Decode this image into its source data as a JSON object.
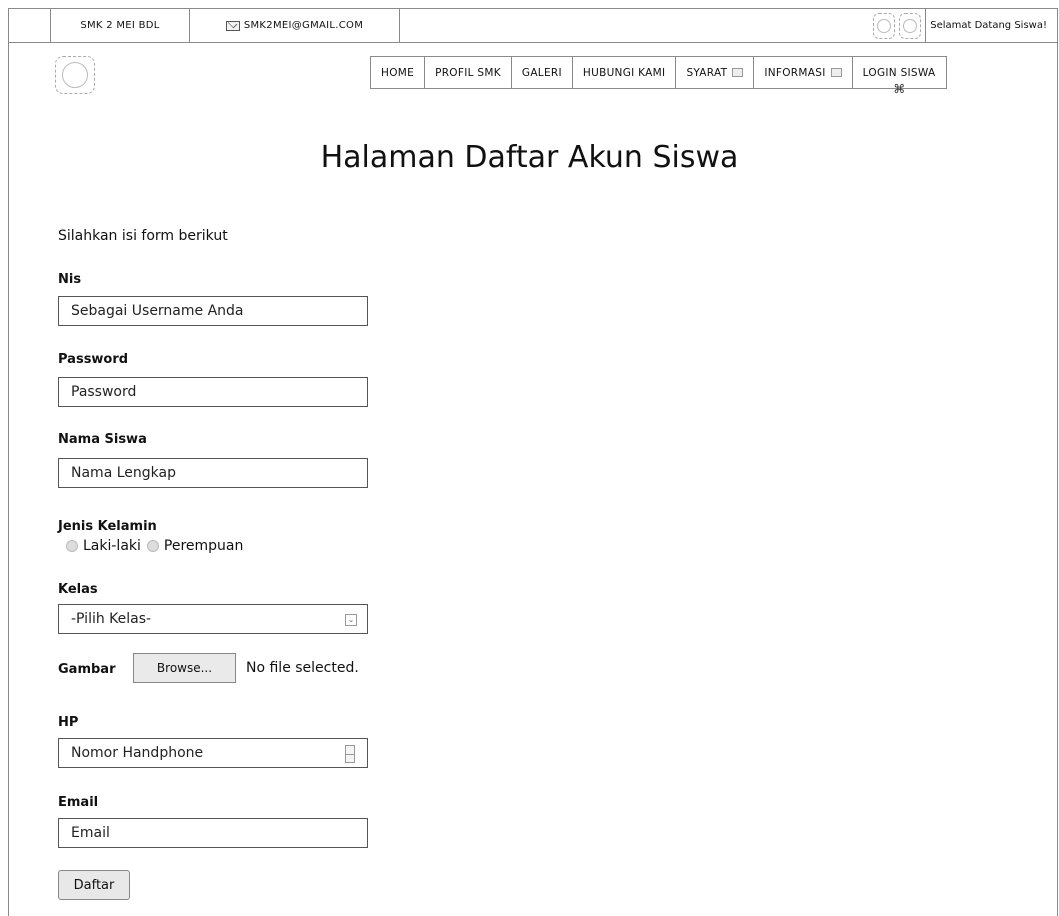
{
  "topbar": {
    "school_name": "SMK 2 MEI BDL",
    "email": "SMK2MEI@GMAIL.COM",
    "welcome": "Selamat Datang Siswa!"
  },
  "nav": {
    "items": [
      {
        "label": "HOME"
      },
      {
        "label": "PROFIL SMK"
      },
      {
        "label": "GALERI"
      },
      {
        "label": "HUBUNGI KAMI"
      },
      {
        "label": "SYARAT"
      },
      {
        "label": "INFORMASI"
      },
      {
        "label": "LOGIN SISWA"
      }
    ]
  },
  "page": {
    "title": "Halaman Daftar Akun Siswa",
    "intro": "Silahkan isi form berikut"
  },
  "form": {
    "nis": {
      "label": "Nis",
      "placeholder": "Sebagai Username Anda"
    },
    "password": {
      "label": "Password",
      "placeholder": "Password"
    },
    "nama": {
      "label": "Nama Siswa",
      "placeholder": "Nama Lengkap"
    },
    "jenis_kelamin": {
      "label": "Jenis Kelamin",
      "options": [
        "Laki-laki",
        "Perempuan"
      ]
    },
    "kelas": {
      "label": "Kelas",
      "selected": "-Pilih Kelas-"
    },
    "gambar": {
      "label": "Gambar",
      "button": "Browse...",
      "status": "No file selected."
    },
    "hp": {
      "label": "HP",
      "placeholder": "Nomor Handphone"
    },
    "email": {
      "label": "Email",
      "placeholder": "Email"
    },
    "submit": "Daftar"
  }
}
